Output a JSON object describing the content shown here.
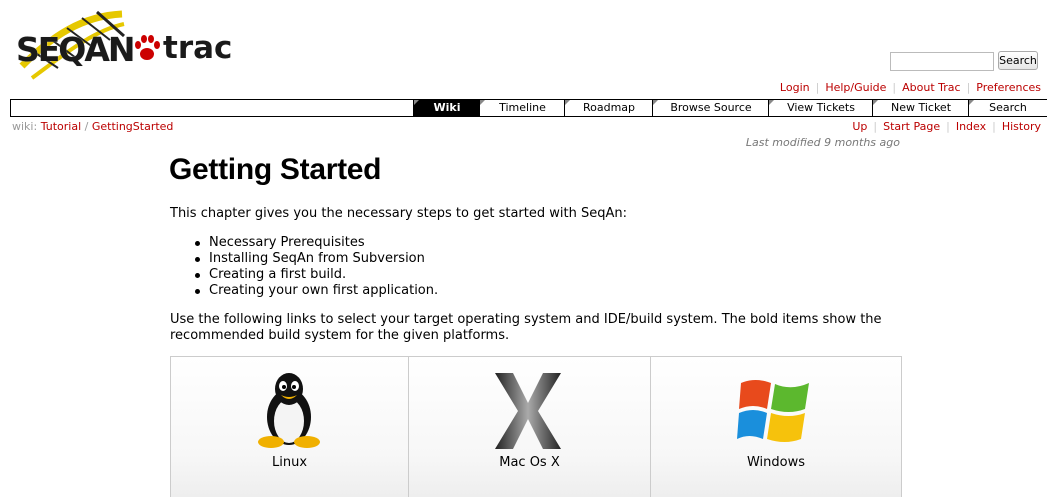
{
  "logo": {
    "name": "SEQAN",
    "product": "trac"
  },
  "search": {
    "placeholder": "",
    "value": "",
    "button": "Search"
  },
  "metanav": [
    "Login",
    "Help/Guide",
    "About Trac",
    "Preferences"
  ],
  "mainnav": [
    "Wiki",
    "Timeline",
    "Roadmap",
    "Browse Source",
    "View Tickets",
    "New Ticket",
    "Search"
  ],
  "breadcrumb": {
    "prefix": "wiki:",
    "items": [
      "Tutorial",
      "GettingStarted"
    ],
    "sep": "/"
  },
  "ctxtnav": [
    "Up",
    "Start Page",
    "Index",
    "History"
  ],
  "last_modified": {
    "label": "Last modified",
    "value": "9 months ago"
  },
  "page": {
    "title": "Getting Started",
    "intro": "This chapter gives you the necessary steps to get started with SeqAn:",
    "steps": [
      "Necessary Prerequisites",
      "Installing SeqAn from Subversion",
      "Creating a first build.",
      "Creating your own first application."
    ],
    "outro": "Use the following links to select your target operating system and IDE/build system. The bold items show the recommended build system for the given platforms.",
    "platforms": [
      "Linux",
      "Mac Os X",
      "Windows"
    ]
  },
  "colors": {
    "link": "#bb0000",
    "nav_active": "#000000"
  }
}
